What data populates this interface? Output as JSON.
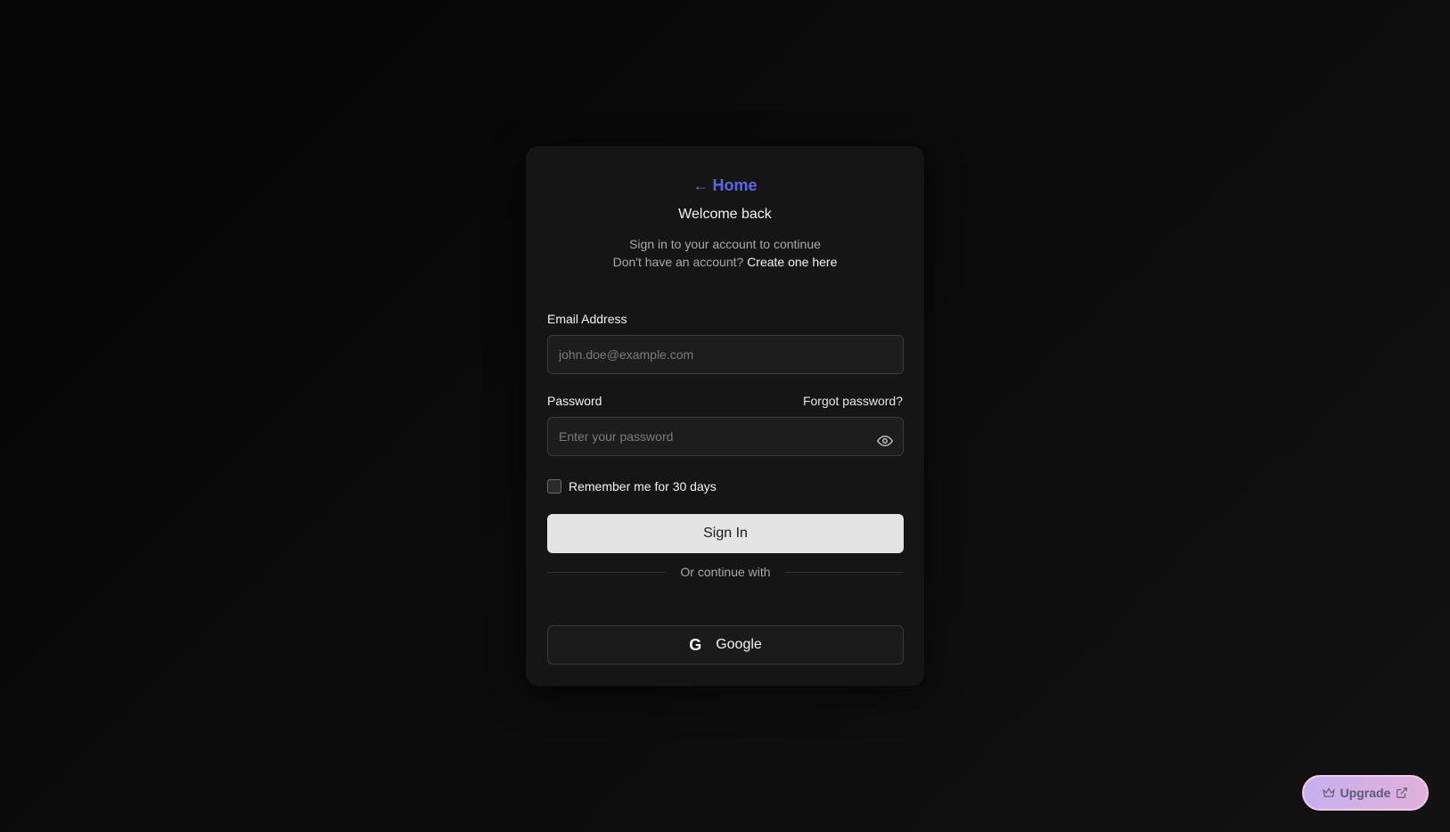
{
  "nav": {
    "home_label": "Home"
  },
  "header": {
    "title": "Welcome back",
    "subtitle": "Sign in to your account to continue",
    "signup_prompt": "Don't have an account?",
    "signup_link": "Create one here"
  },
  "form": {
    "email_label": "Email Address",
    "email_placeholder": "john.doe@example.com",
    "email_value": "",
    "password_label": "Password",
    "forgot_label": "Forgot password?",
    "password_placeholder": "Enter your password",
    "password_value": "",
    "remember_label": "Remember me for 30 days",
    "remember_checked": false,
    "submit_label": "Sign In"
  },
  "social": {
    "divider_text": "Or continue with",
    "google_label": "Google",
    "google_icon": "G"
  },
  "upgrade": {
    "label": "Upgrade"
  },
  "colors": {
    "accent": "#5b67e6",
    "background": "#0a0a0a",
    "card": "#151515"
  }
}
